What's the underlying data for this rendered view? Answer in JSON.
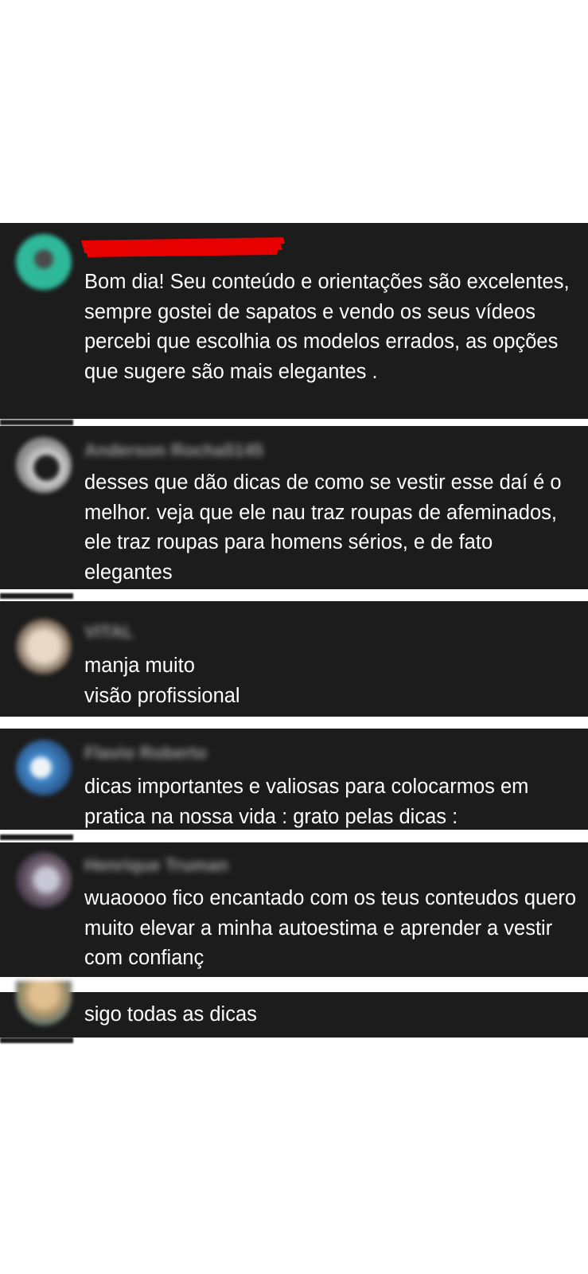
{
  "comments": [
    {
      "username": "",
      "username_redacted": true,
      "text": "Bom dia! Seu conteúdo e orientações são excelentes, sempre gostei de sapatos e vendo os seus vídeos percebi que escolhia os modelos errados, as opções que sugere são mais elegantes .",
      "avatar_color": "#2fb89a"
    },
    {
      "username": "Anderson Rocha5145",
      "text": "desses que dão dicas de como se vestir esse daí é o melhor. veja que ele nau traz roupas de afeminados, ele traz roupas para homens sérios, e de fato elegantes",
      "avatar_color": "#8a8a8a"
    },
    {
      "username": "VITAL",
      "text": "manja muito\nvisão profissional",
      "avatar_color": "#c9b9a8"
    },
    {
      "username": "Flavio Roberto",
      "text": "dicas importantes e valiosas para colocarmos em pratica na nossa vida : grato pelas dicas :",
      "avatar_color": "#3f86c8"
    },
    {
      "username": "Henrique Truman",
      "text": "wuaoooo fico encantado com os teus conteudos quero muito elevar a minha autoestima e aprender a vestir com confianç",
      "avatar_color": "#7a6a78"
    },
    {
      "username": "",
      "text": "sigo todas as dicas",
      "avatar_color": "#b59a6e"
    }
  ],
  "colors": {
    "card_background": "#1c1c1c",
    "page_background": "#ffffff",
    "comment_text": "#ffffff",
    "username_text": "#9a9a9a",
    "redaction": "#e60000"
  }
}
